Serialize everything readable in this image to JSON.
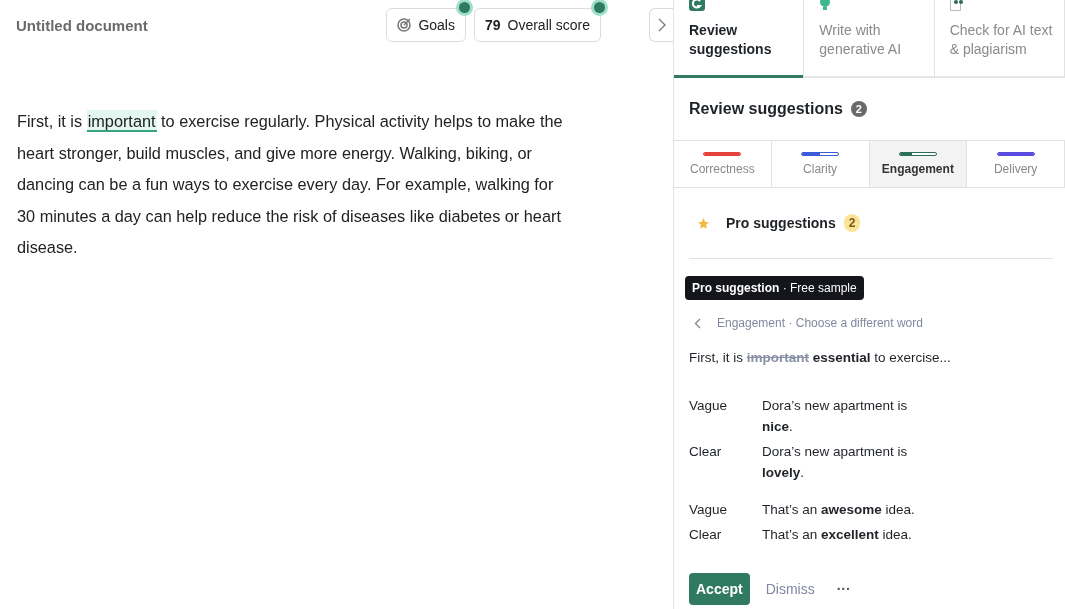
{
  "document": {
    "title": "Untitled document",
    "paragraph": [
      {
        "text": "First, it is ",
        "highlighted": false
      },
      {
        "text": "important",
        "highlighted": true
      },
      {
        "text": " to exercise regularly. Physical activity helps to make the heart stronger, build muscles, and give more energy. Walking, biking, or dancing can be a fun ways to exercise every day. For example, walking for 30 minutes a day can help reduce the risk of diseases like diabetes or heart disease.",
        "highlighted": false
      }
    ]
  },
  "toolbar": {
    "goals": "Goals",
    "score": "79",
    "score_label": "Overall score"
  },
  "panel_tabs": [
    {
      "label": "Review suggestions",
      "selected": true
    },
    {
      "label": "Write with generative AI",
      "selected": false
    },
    {
      "label": "Check for AI text & plagiarism",
      "selected": false
    }
  ],
  "review": {
    "title": "Review suggestions",
    "count": "2"
  },
  "categories": [
    {
      "label": "Correctness",
      "color": "#e5433a",
      "level": 1,
      "selected": false
    },
    {
      "label": "Clarity",
      "color": "#3d5bd9",
      "level": 0.5,
      "selected": false
    },
    {
      "label": "Engagement",
      "color": "#2b6e5a",
      "level": 0.35,
      "selected": true
    },
    {
      "label": "Delivery",
      "color": "#5a4be0",
      "level": 1,
      "selected": false
    }
  ],
  "pro": {
    "title": "Pro suggestions",
    "count": "2"
  },
  "card": {
    "tag_bold": "Pro suggestion",
    "tag_rest": " · Free sample",
    "breadcrumb": "Engagement · Choose a different word",
    "preview": [
      {
        "text": "First, it is ",
        "kind": "plain"
      },
      {
        "text": "important",
        "kind": "struck"
      },
      {
        "text": " essential",
        "kind": "bold"
      },
      {
        "text": " to exercise...",
        "kind": "plain"
      }
    ],
    "examples": [
      [
        {
          "label": "Vague",
          "text": "Dora’s new apartment is **nice**."
        },
        {
          "label": "Clear",
          "text": "Dora’s new apartment is **lovely**."
        }
      ],
      [
        {
          "label": "Vague",
          "text": "That’s an **awesome** idea."
        },
        {
          "label": "Clear",
          "text": "That’s an **excellent** idea."
        }
      ]
    ],
    "accept": "Accept",
    "dismiss": "Dismiss",
    "more": "···"
  }
}
